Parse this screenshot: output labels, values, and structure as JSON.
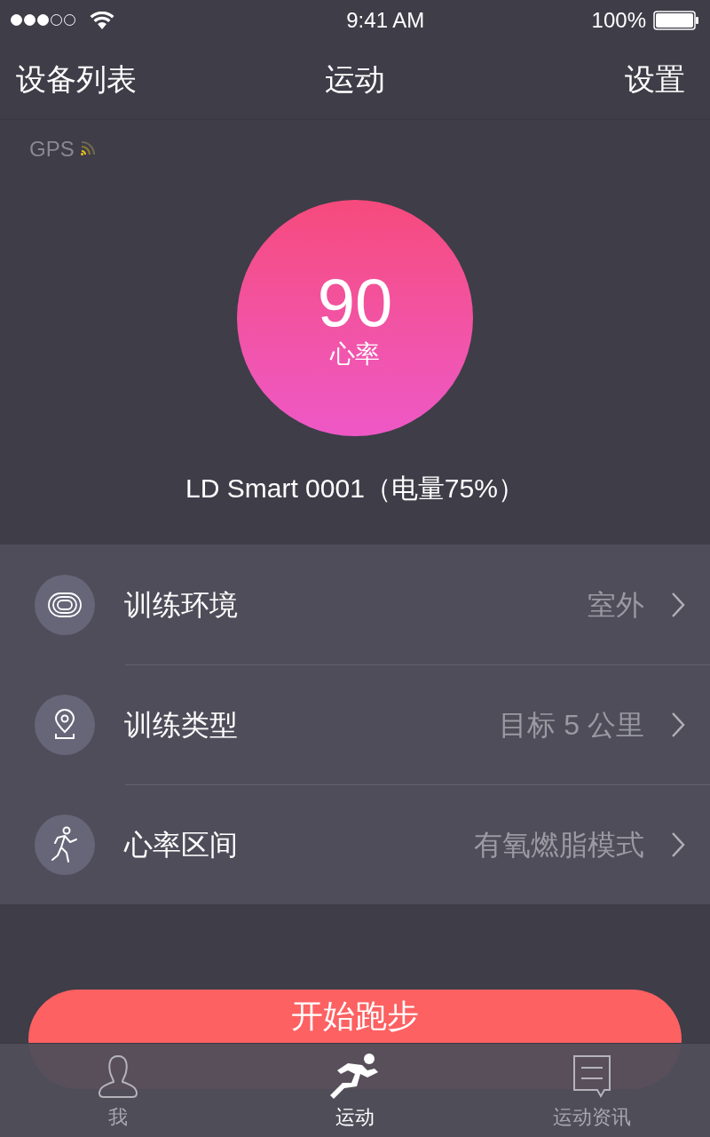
{
  "status_bar": {
    "signal_dots": [
      {
        "filled": true
      },
      {
        "filled": true
      },
      {
        "filled": true
      },
      {
        "filled": false
      },
      {
        "filled": false
      }
    ],
    "time": "9:41 AM",
    "battery": "100%"
  },
  "nav": {
    "left": "设备列表",
    "title": "运动",
    "right": "设置"
  },
  "gps": {
    "label": "GPS"
  },
  "heart": {
    "value": "90",
    "label": "心率"
  },
  "device": "LD Smart 0001（电量75%）",
  "settings": [
    {
      "kind": "track",
      "label": "训练环境",
      "value": "室外"
    },
    {
      "kind": "pin",
      "label": "训练类型",
      "value": "目标 5 公里"
    },
    {
      "kind": "runner",
      "label": "心率区间",
      "value": "有氧燃脂模式"
    }
  ],
  "start_button": "开始跑步",
  "tabs": [
    {
      "kind": "person",
      "label": "我",
      "selected": false
    },
    {
      "kind": "runner",
      "label": "运动",
      "selected": true
    },
    {
      "kind": "chat",
      "label": "运动资讯",
      "selected": false
    }
  ]
}
